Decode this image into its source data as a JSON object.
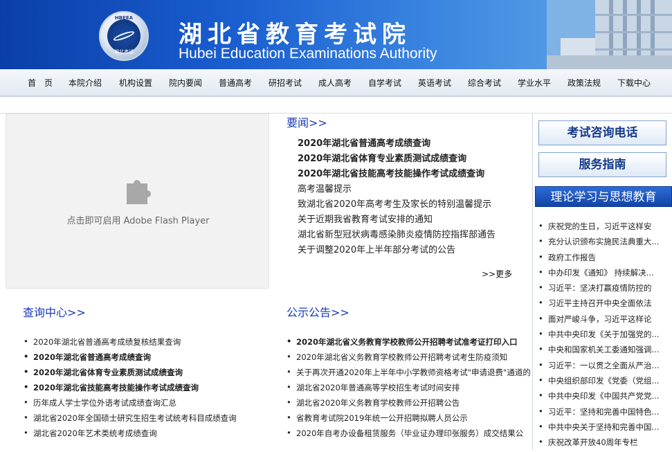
{
  "header": {
    "title_cn": "湖北省教育考试院",
    "title_en": "Hubei Education Examinations Authority",
    "logo_abbr": "HBEEA",
    "logo_text": "湖北考试"
  },
  "nav": {
    "items": [
      "首　页",
      "本院介绍",
      "机构设置",
      "院内要闻",
      "普通高考",
      "研招考试",
      "成人高考",
      "自学考试",
      "英语考试",
      "综合考试",
      "学业水平",
      "政策法规",
      "下载中心"
    ]
  },
  "flash": {
    "message": "点击即可启用 Adobe Flash Player"
  },
  "news": {
    "title": "要闻>>",
    "more": ">>更多",
    "items": [
      {
        "text": "2020年湖北省普通高考成绩查询",
        "bold": true
      },
      {
        "text": "2020年湖北省体育专业素质测试成绩查询",
        "bold": true
      },
      {
        "text": "2020年湖北省技能高考技能操作考试成绩查询",
        "bold": true
      },
      {
        "text": "高考温馨提示",
        "bold": false
      },
      {
        "text": "致湖北省2020年高考考生及家长的特别温馨提示",
        "bold": false
      },
      {
        "text": "关于近期我省教育考试安排的通知",
        "bold": false
      },
      {
        "text": "湖北省新型冠状病毒感染肺炎疫情防控指挥部通告",
        "bold": false
      },
      {
        "text": "关于调整2020年上半年部分考试的公告",
        "bold": false
      }
    ]
  },
  "query": {
    "title": "查询中心>>",
    "items": [
      {
        "text": "2020年湖北省普通高考成绩复核结果查询",
        "bold": false
      },
      {
        "text": "2020年湖北省普通高考成绩查询",
        "bold": true
      },
      {
        "text": "2020年湖北省体育专业素质测试成绩查询",
        "bold": true
      },
      {
        "text": "2020年湖北省技能高考技能操作考试成绩查询",
        "bold": true
      },
      {
        "text": "历年成人学士学位外语考试成绩查询汇总",
        "bold": false
      },
      {
        "text": "湖北省2020年全国硕士研究生招生考试统考科目成绩查询",
        "bold": false
      },
      {
        "text": "湖北省2020年艺术类统考成绩查询",
        "bold": false
      }
    ]
  },
  "notice": {
    "title": "公示公告>>",
    "items": [
      {
        "text": "2020年湖北省义务教育学校教师公开招聘考试准考证打印入口",
        "bold": true
      },
      {
        "text": "2020年湖北省义务教育学校教师公开招聘考试考生防疫须知",
        "bold": false
      },
      {
        "text": "关于再次开通2020年上半年中小学教师资格考试\"申请退费\"通道的",
        "bold": false
      },
      {
        "text": "湖北省2020年普通高等学校招生考试时间安排",
        "bold": false
      },
      {
        "text": "湖北省2020年义务教育学校教师公开招聘公告",
        "bold": false
      },
      {
        "text": "省教育考试院2019年统一公开招聘拟聘人员公示",
        "bold": false
      },
      {
        "text": "2020年自考办设备租赁服务（毕业证办理印张服务）成交结果公",
        "bold": false
      }
    ]
  },
  "sidebar": {
    "btn_phone": "考试咨询电话",
    "btn_guide": "服务指南",
    "section_title": "理论学习与思想教育",
    "items": [
      "庆祝党的生日，习近平这样安",
      "充分认识颁布实施民法典重大...",
      "政府工作报告",
      "中办印发《通知》 持续解决...",
      "习近平：坚决打赢疫情防控的",
      "习近平主持召开中央全面依法",
      "面对严峻斗争，习近平这样论",
      "中共中央印发《关于加强党的...",
      "中央和国家机关工委通知强调...",
      "习近平：一以贯之全面从严治...",
      "中央组织部印发《党委（党组...",
      "中共中央印发《中国共产党党...",
      "习近平：坚持和完善中国特色...",
      "中共中央关于坚持和完善中国...",
      "庆祝改革开放40周年专栏"
    ]
  },
  "colors": {
    "accent": "#1a39b8",
    "banner": "#1a5ed0",
    "sidebar_header": "#1244a6"
  }
}
